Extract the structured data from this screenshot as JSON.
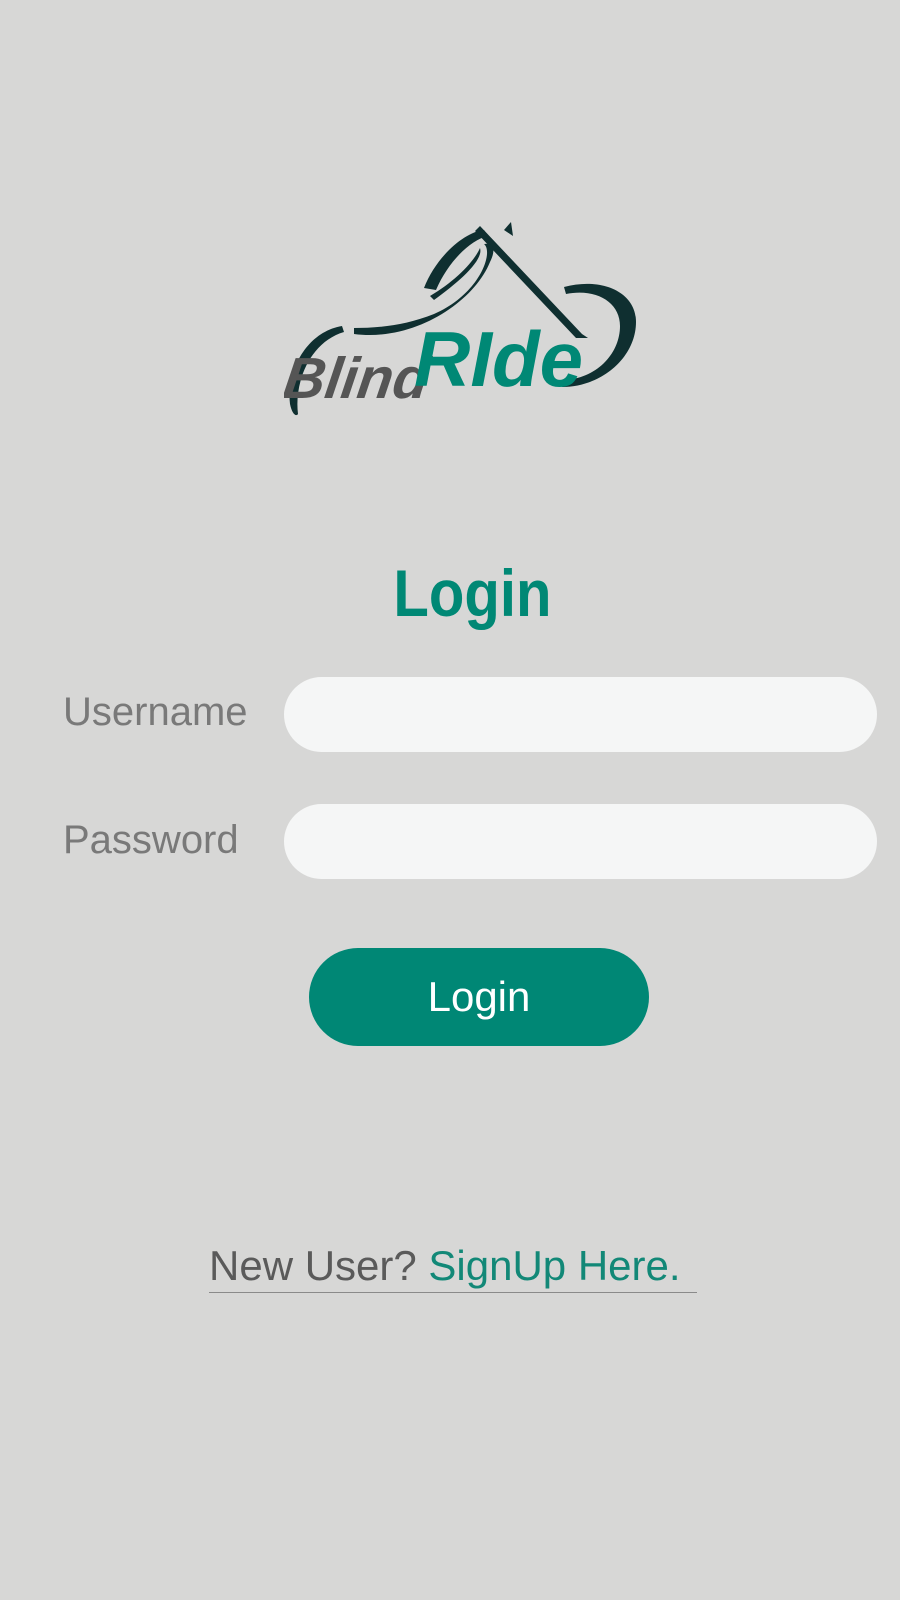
{
  "brand": {
    "logo_name": "BlindRide",
    "logo_part1": "Blind",
    "logo_part2": "RIde",
    "colors": {
      "accent": "#008875",
      "dark": "#0f2f30",
      "grey_text": "#555555"
    }
  },
  "form": {
    "heading": "Login",
    "username": {
      "label": "Username",
      "value": "",
      "placeholder": ""
    },
    "password": {
      "label": "Password",
      "value": "",
      "placeholder": ""
    },
    "submit_label": "Login"
  },
  "signup": {
    "prompt": "New User?",
    "link_label": "SignUp Here."
  },
  "colors": {
    "background": "#d7d7d6",
    "input_background": "#f5f6f6",
    "button": "#008775",
    "label_text": "#797979"
  }
}
